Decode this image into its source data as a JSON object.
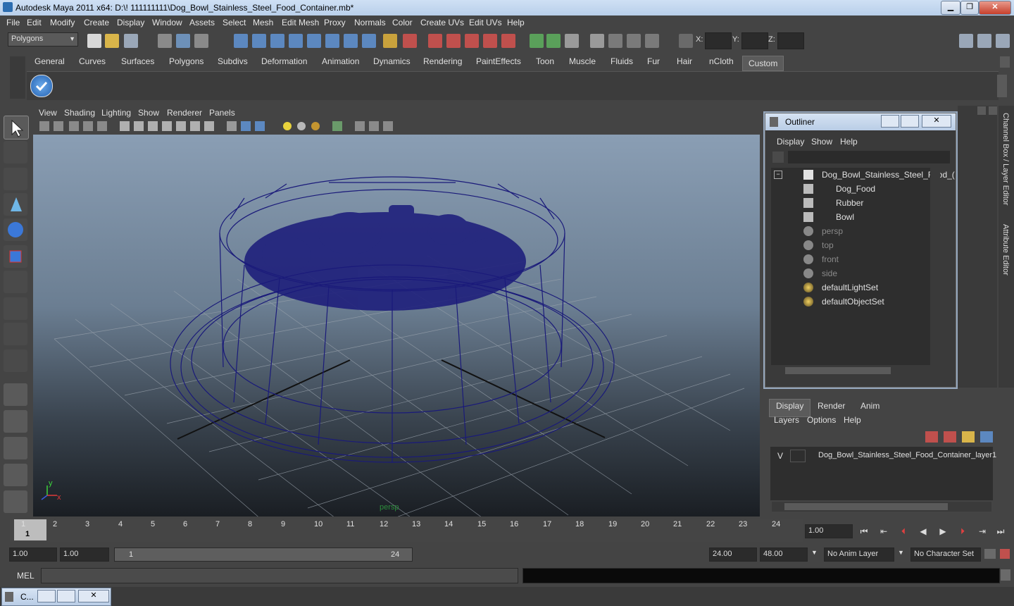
{
  "window": {
    "title": "Autodesk Maya 2011 x64: D:\\! 111111111\\Dog_Bowl_Stainless_Steel_Food_Container.mb*",
    "minimize": "▁",
    "maximize": "❐",
    "close": "✕"
  },
  "menubar": [
    "File",
    "Edit",
    "Modify",
    "Create",
    "Display",
    "Window",
    "Assets",
    "Select",
    "Mesh",
    "Edit Mesh",
    "Proxy",
    "Normals",
    "Color",
    "Create UVs",
    "Edit UVs",
    "Help"
  ],
  "toolbar": {
    "mode": "Polygons",
    "x_label": "X:",
    "y_label": "Y:",
    "z_label": "Z:"
  },
  "shelf": {
    "tabs": [
      "General",
      "Curves",
      "Surfaces",
      "Polygons",
      "Subdivs",
      "Deformation",
      "Animation",
      "Dynamics",
      "Rendering",
      "PaintEffects",
      "Toon",
      "Muscle",
      "Fluids",
      "Fur",
      "Hair",
      "nCloth",
      "Custom"
    ],
    "active": "Custom"
  },
  "viewport": {
    "menu": [
      "View",
      "Shading",
      "Lighting",
      "Show",
      "Renderer",
      "Panels"
    ],
    "camera_label": "persp",
    "axis_y": "y",
    "axis_x": "x"
  },
  "outliner": {
    "title": "Outliner",
    "menu": [
      "Display",
      "Show",
      "Help"
    ],
    "items": [
      {
        "label": "Dog_Bowl_Stainless_Steel_Food_(",
        "indent": 0,
        "icon": "group-icon",
        "dim": false
      },
      {
        "label": "Dog_Food",
        "indent": 1,
        "icon": "mesh-icon",
        "dim": false
      },
      {
        "label": "Rubber",
        "indent": 1,
        "icon": "mesh-icon",
        "dim": false
      },
      {
        "label": "Bowl",
        "indent": 1,
        "icon": "mesh-icon",
        "dim": false
      },
      {
        "label": "persp",
        "indent": 0,
        "icon": "camera-icon",
        "dim": true
      },
      {
        "label": "top",
        "indent": 0,
        "icon": "camera-icon",
        "dim": true
      },
      {
        "label": "front",
        "indent": 0,
        "icon": "camera-icon",
        "dim": true
      },
      {
        "label": "side",
        "indent": 0,
        "icon": "camera-icon",
        "dim": true
      },
      {
        "label": "defaultLightSet",
        "indent": 0,
        "icon": "set-icon",
        "dim": false
      },
      {
        "label": "defaultObjectSet",
        "indent": 0,
        "icon": "set-icon",
        "dim": false
      }
    ]
  },
  "side_tabs": {
    "channel_box": "Channel Box / Layer Editor",
    "attribute_editor": "Attribute Editor"
  },
  "layer_editor": {
    "tabs": [
      "Display",
      "Render",
      "Anim"
    ],
    "active": "Display",
    "menu": [
      "Layers",
      "Options",
      "Help"
    ],
    "layer_visible": "V",
    "layer_name": "Dog_Bowl_Stainless_Steel_Food_Container_layer1"
  },
  "timeline": {
    "ticks": [
      "1",
      "2",
      "3",
      "4",
      "5",
      "6",
      "7",
      "8",
      "9",
      "10",
      "11",
      "12",
      "13",
      "14",
      "15",
      "16",
      "17",
      "18",
      "19",
      "20",
      "21",
      "22",
      "23",
      "24"
    ],
    "current_frame_marker": "1",
    "current_time": "1.00"
  },
  "range": {
    "start": "1.00",
    "start_inner": "1.00",
    "slider_start": "1",
    "slider_end": "24",
    "end_inner": "24.00",
    "end": "48.00",
    "anim_layer": "No Anim Layer",
    "char_set": "No Character Set"
  },
  "command_line": {
    "label": "MEL"
  },
  "taskbar": {
    "item": "C..."
  },
  "colors": {
    "wireframe": "#1a1a7a",
    "background": "#444444",
    "accent": "#5b5b5b"
  }
}
